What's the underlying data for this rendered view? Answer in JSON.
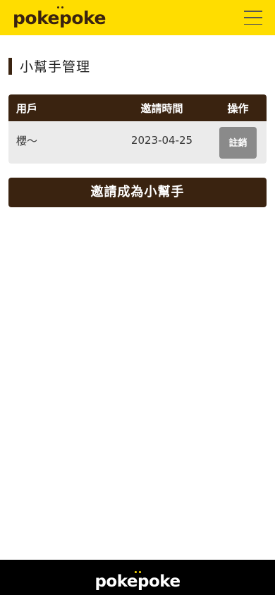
{
  "header": {
    "logo_text": "pokepoke",
    "menu_icon": "hamburger-menu-icon",
    "background_color": "#FFDD00"
  },
  "page": {
    "title": "小幫手管理"
  },
  "table": {
    "columns": [
      "用戶",
      "邀請時間",
      "操作"
    ],
    "rows": [
      {
        "user": "櫻～",
        "invite_time": "2023-04-25",
        "action_label": "註銷"
      }
    ]
  },
  "invite_button_label": "邀請成為小幫手",
  "footer": {
    "logo_text": "pokepoke"
  },
  "colors": {
    "brand_brown": "#3A2310",
    "brand_yellow": "#FFDD00",
    "row_bg": "#EBEBEB",
    "revoke_button": "#8A8A8A"
  }
}
